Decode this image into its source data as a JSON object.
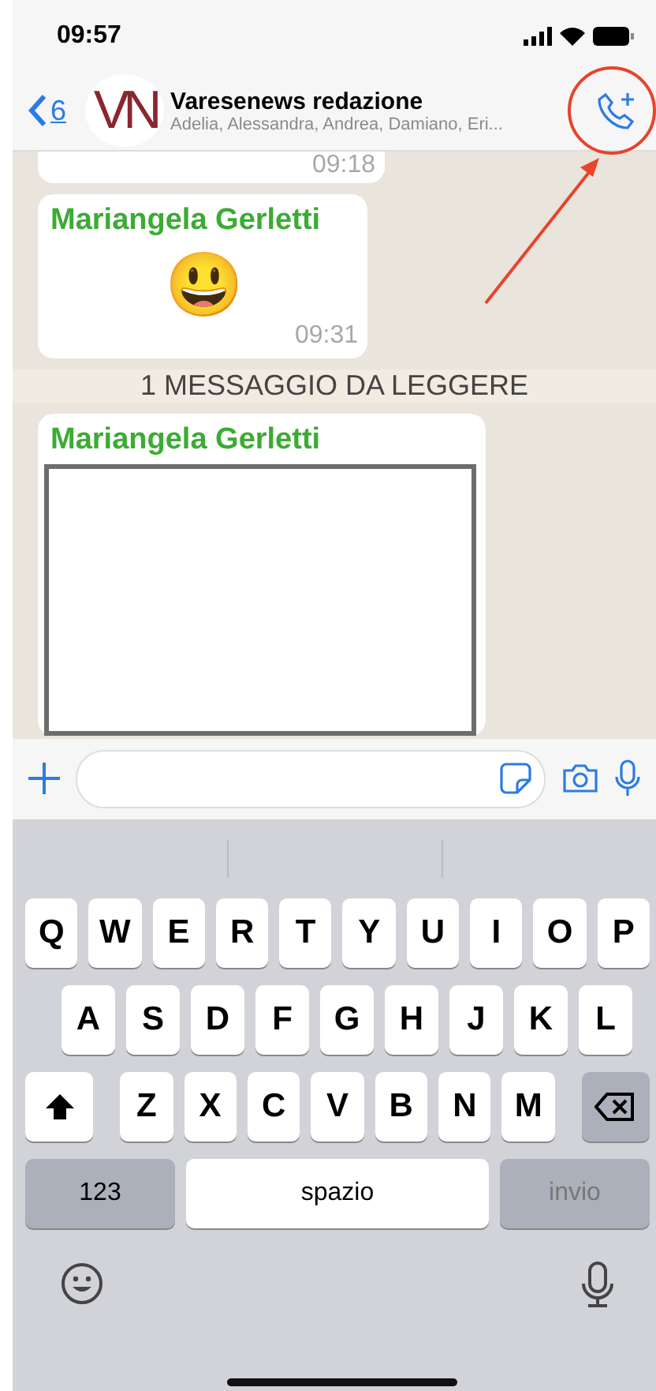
{
  "status_bar": {
    "time": "09:57"
  },
  "header": {
    "back_count": "6",
    "logo": "VN",
    "title": "Varesenews redazione",
    "subtitle": "Adelia, Alessandra, Andrea, Damiano, Eri..."
  },
  "messages": [
    {
      "kind": "partial",
      "time": "09:18"
    },
    {
      "kind": "emoji",
      "sender": "Mariangela Gerletti",
      "text": "😃",
      "time": "09:31"
    },
    {
      "kind": "divider",
      "text": "1 MESSAGGIO DA LEGGERE"
    },
    {
      "kind": "image",
      "sender": "Mariangela Gerletti"
    }
  ],
  "keyboard": {
    "rows": [
      {
        "keys": [
          {
            "kind": "letter",
            "label": "Q"
          },
          {
            "kind": "letter",
            "label": "W"
          },
          {
            "kind": "letter",
            "label": "E"
          },
          {
            "kind": "letter",
            "label": "R"
          },
          {
            "kind": "letter",
            "label": "T"
          },
          {
            "kind": "letter",
            "label": "Y"
          },
          {
            "kind": "letter",
            "label": "U"
          },
          {
            "kind": "letter",
            "label": "I"
          },
          {
            "kind": "letter",
            "label": "O"
          },
          {
            "kind": "letter",
            "label": "P"
          }
        ]
      },
      {
        "keys": [
          {
            "kind": "letter",
            "label": "A"
          },
          {
            "kind": "letter",
            "label": "S"
          },
          {
            "kind": "letter",
            "label": "D"
          },
          {
            "kind": "letter",
            "label": "F"
          },
          {
            "kind": "letter",
            "label": "G"
          },
          {
            "kind": "letter",
            "label": "H"
          },
          {
            "kind": "letter",
            "label": "J"
          },
          {
            "kind": "letter",
            "label": "K"
          },
          {
            "kind": "letter",
            "label": "L"
          }
        ]
      },
      {
        "keys": [
          {
            "kind": "shift"
          },
          {
            "kind": "letter",
            "label": "Z"
          },
          {
            "kind": "letter",
            "label": "X"
          },
          {
            "kind": "letter",
            "label": "C"
          },
          {
            "kind": "letter",
            "label": "V"
          },
          {
            "kind": "letter",
            "label": "B"
          },
          {
            "kind": "letter",
            "label": "N"
          },
          {
            "kind": "letter",
            "label": "M"
          },
          {
            "kind": "backspace"
          }
        ]
      },
      {
        "keys": [
          {
            "kind": "numbers",
            "label": "123"
          },
          {
            "kind": "space",
            "label": "spazio"
          },
          {
            "kind": "return",
            "label": "invio",
            "disabled": true
          }
        ]
      }
    ]
  }
}
